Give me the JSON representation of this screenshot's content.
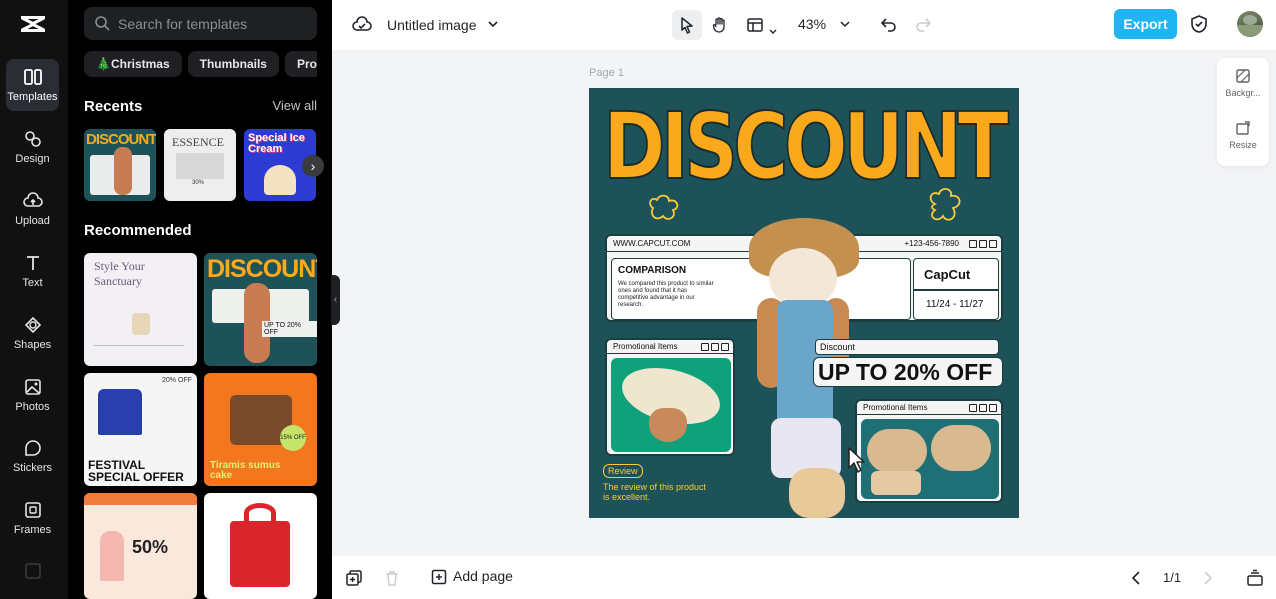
{
  "app": {
    "accent": "#1fb5f2",
    "doc_title": "Untitled image"
  },
  "rail": {
    "items": [
      {
        "label": "Templates",
        "icon": "templates-icon"
      },
      {
        "label": "Design",
        "icon": "design-icon"
      },
      {
        "label": "Upload",
        "icon": "upload-icon"
      },
      {
        "label": "Text",
        "icon": "text-icon"
      },
      {
        "label": "Shapes",
        "icon": "shapes-icon"
      },
      {
        "label": "Photos",
        "icon": "photos-icon"
      },
      {
        "label": "Stickers",
        "icon": "stickers-icon"
      },
      {
        "label": "Frames",
        "icon": "frames-icon"
      }
    ]
  },
  "panel": {
    "search_placeholder": "Search for templates",
    "chips": [
      "🎄Christmas",
      "Thumbnails",
      "Prod"
    ],
    "recents_title": "Recents",
    "view_all": "View all",
    "recommended_title": "Recommended",
    "recent_thumbs": [
      {
        "text": "DISCOUNT"
      },
      {
        "text": "ESSENCE",
        "sub": "30%"
      },
      {
        "text": "Special Ice Cream"
      }
    ],
    "recommended_thumbs": [
      {
        "text": "Style Your Sanctuary"
      },
      {
        "text": "DISCOUNT",
        "sub": "UP TO 20% OFF"
      },
      {
        "text": "FESTIVAL SPECIAL OFFER",
        "sub": "20% OFF"
      },
      {
        "text": "Tiramis sumus cake",
        "sub": "15% OFF"
      },
      {
        "text": "50%"
      },
      {
        "text": ""
      }
    ]
  },
  "toolbar": {
    "zoom": "43%",
    "export_label": "Export"
  },
  "canvas": {
    "page_label": "Page 1",
    "side_tools": [
      "Backgr...",
      "Resize"
    ]
  },
  "design": {
    "headline": "DISCOUNT",
    "url": "WWW.CAPCUT.COM",
    "phone": "+123-456-7890",
    "comparison_title": "COMPARISON",
    "comparison_body": "We compared this product to similar ones and found that it has competitive advantage in our research.",
    "brand": "CapCut",
    "dates": "11/24 - 11/27",
    "promo_items_label": "Promotional Items",
    "discount_label": "Discount",
    "discount_text": "UP TO 20% OFF",
    "promo_items_label2": "Promotional Items",
    "review_label": "Review",
    "review_text": "The review of this product is excellent.",
    "colors": {
      "bg": "#1d5358",
      "headline": "#f9a91b",
      "review": "#f9c93a"
    }
  },
  "bottom": {
    "add_page": "Add page",
    "pager": "1/1"
  }
}
